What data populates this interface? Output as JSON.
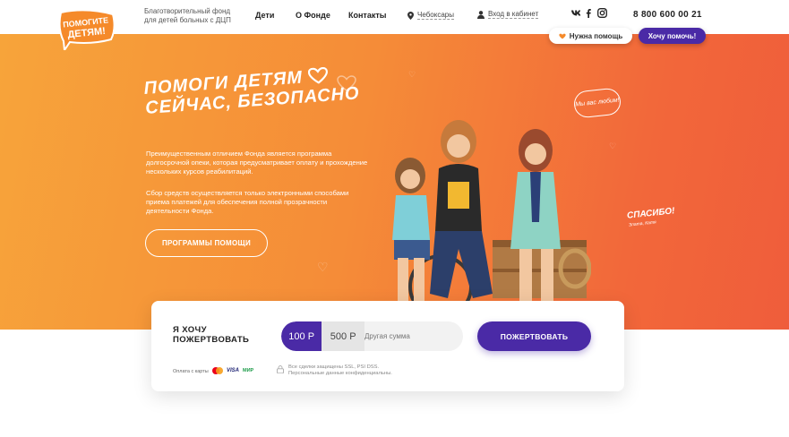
{
  "header": {
    "logo_text": "ПОМОГИТЕ ДЕТЯМ!",
    "tagline": "Благотворительный фонд для детей больных с ДЦП",
    "nav": [
      "Дети",
      "О Фонде",
      "Контакты"
    ],
    "city": "Чебоксары",
    "login": "Вход в кабинет",
    "social": [
      "vk-icon",
      "facebook-icon",
      "instagram-icon"
    ],
    "phone": "8 800 600 00 21",
    "need_help_label": "Нужна помощь",
    "want_help_label": "Хочу помочь!"
  },
  "hero": {
    "title_line1": "ПОМОГИ ДЕТЯМ",
    "title_line2": "СЕЙЧАС, БЕЗОПАСНО",
    "paragraph1": "Преимущественным отличием Фонда является программа долгосрочной опеки, которая предусматривает оплату и прохождение нескольких курсов реабилитаций.",
    "paragraph2": "Сбор средств осуществляется только электронными способами приема платежей для обеспечения полной прозрачности деятельности Фонда.",
    "programs_button": "ПРОГРАММЫ ПОМОЩИ",
    "bubble_text": "Мы вас любим!",
    "thanks_text": "СПАСИБО!",
    "thanks_sub": "Злата, Катя"
  },
  "donation": {
    "title": "Я ХОЧУ ПОЖЕРТВОВАТЬ",
    "amount1": "100 Р",
    "amount2": "500 Р",
    "other_placeholder": "Другая сумма",
    "donate_button": "ПОЖЕРТВОВАТЬ",
    "pay_label": "Оплата с карты",
    "visa": "VISA",
    "mir": "МИР",
    "secure_line1": "Все сделки защищены SSL, PSI DSS.",
    "secure_line2": "Персональные данные конфиденциальны."
  },
  "colors": {
    "accent": "#4a2aa6",
    "hero_start": "#f7a43a",
    "hero_end": "#ef5d3b"
  }
}
